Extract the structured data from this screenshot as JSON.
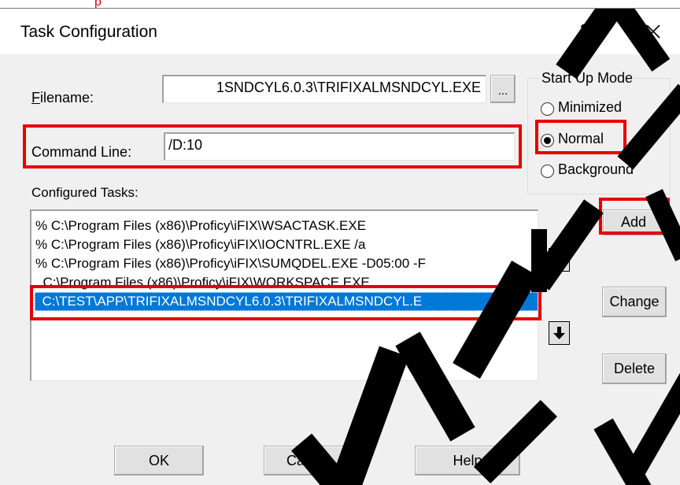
{
  "top_fragment": "p",
  "window": {
    "title": "Task Configuration",
    "help_label": "?",
    "close_icon": "close-icon"
  },
  "filename": {
    "label": "Filename:",
    "label_access_key": "F",
    "value": "1SNDCYL6.0.3\\TRIFIXALMSNDCYL.EXE",
    "browse_label": "..."
  },
  "command_line": {
    "label": "Command Line:",
    "value": "/D:10"
  },
  "start_up_mode": {
    "title": "Start Up Mode",
    "options": [
      {
        "label": "Minimized",
        "checked": false
      },
      {
        "label": "Normal",
        "checked": true
      },
      {
        "label": "Background",
        "checked": false
      }
    ]
  },
  "configured_tasks": {
    "label": "Configured Tasks:",
    "items": [
      "% C:\\Program Files (x86)\\Proficy\\iFIX\\WSACTASK.EXE",
      "% C:\\Program Files (x86)\\Proficy\\iFIX\\IOCNTRL.EXE  /a",
      "% C:\\Program Files (x86)\\Proficy\\iFIX\\SUMQDEL.EXE  -D05:00 -F",
      "  C:\\Program Files (x86)\\Proficy\\iFIX\\WORKSPACE.EXE",
      "  C:\\TEST\\APP\\TRIFIXALMSNDCYL6.0.3\\TRIFIXALMSNDCYL.E"
    ],
    "selected_index": 4
  },
  "side_buttons": {
    "add": "Add",
    "change": "Change",
    "delete": "Delete",
    "move_up_icon": "arrow-up-icon",
    "move_down_icon": "arrow-down-icon"
  },
  "footer_buttons": {
    "ok": "OK",
    "cancel": "Cancel",
    "help": "Help"
  },
  "highlight_color": "#e60000",
  "selection_color": "#0078d7"
}
